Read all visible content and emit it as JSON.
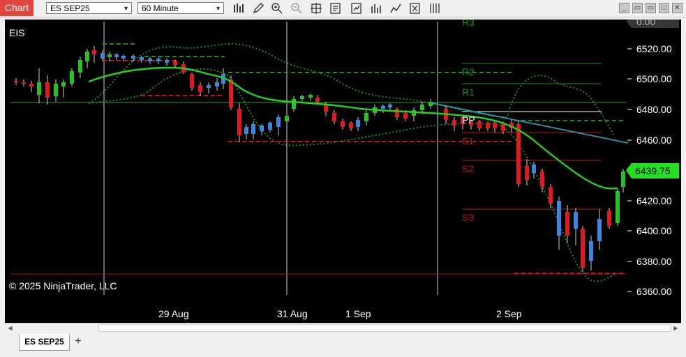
{
  "toolbar": {
    "chart_label": "Chart",
    "instrument": "ES SEP25",
    "interval": "60 Minute",
    "tool_icons": [
      "bar-type-icon",
      "pencil-icon",
      "zoom-in-icon",
      "zoom-out-icon",
      "crosshair-icon",
      "data-box-icon",
      "strategies-icon",
      "indicators-icon",
      "drawing-tools-icon",
      "properties-icon",
      "grid-icon"
    ]
  },
  "window_controls": [
    "minimize-icon",
    "tile-icon",
    "maximize-icon",
    "close-icon"
  ],
  "chart": {
    "instrument_label": "EIS",
    "copyright": "© 2025 NinjaTrader, LLC",
    "current_price": "6439.75",
    "top_partial_price": "0.00",
    "price_ticks": [
      "6520.00",
      "6500.00",
      "6480.00",
      "6460.00",
      "6440.00",
      "6420.00",
      "6400.00",
      "6380.00",
      "6360.00"
    ],
    "date_labels": [
      "29 Aug",
      "31 Aug",
      "1 Sep",
      "2 Sep"
    ],
    "pivot_labels": [
      "R3",
      "R2",
      "R1",
      "PP",
      "S1",
      "S2",
      "S3"
    ],
    "colors": {
      "up": "#22c322",
      "down": "#e0191c",
      "neutral_up": "#3b86de",
      "ma": "#22d322",
      "bands": "#1e8e1e",
      "trendline": "#2a8fa3",
      "pivot_green": "#1f8a1f",
      "pivot_red": "#c0161c",
      "pp": "#ffffff",
      "price_box": "#22e022"
    }
  },
  "bottom": {
    "tab_label": "ES SEP25",
    "add_label": "+"
  }
}
